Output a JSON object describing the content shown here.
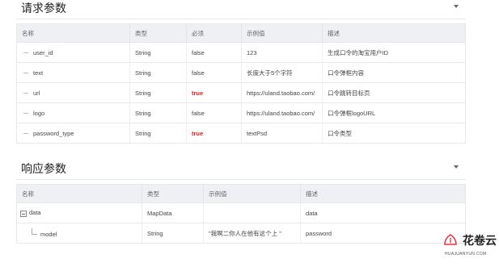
{
  "request": {
    "title": "请求参数",
    "headers": [
      "名称",
      "类型",
      "必须",
      "示例值",
      "描述"
    ],
    "rows": [
      {
        "name": "user_id",
        "type": "String",
        "required": "false",
        "example": "123",
        "desc": "生成口令的淘宝用户ID"
      },
      {
        "name": "text",
        "type": "String",
        "required": "false",
        "example": "长度大于5个字符",
        "desc": "口令弹框内容"
      },
      {
        "name": "url",
        "type": "String",
        "required": "true",
        "example": "https://uland.taobao.com/",
        "desc": "口令跳转目标页"
      },
      {
        "name": "logo",
        "type": "String",
        "required": "false",
        "example": "https://uland.taobao.com/",
        "desc": "口令弹框logoURL"
      },
      {
        "name": "password_type",
        "type": "String",
        "required": "true",
        "example": "textPsd",
        "desc": "口令类型"
      }
    ]
  },
  "response": {
    "title": "响应参数",
    "headers": [
      "名称",
      "类型",
      "示例值",
      "描述"
    ],
    "rows": [
      {
        "name": "data",
        "type": "MapData",
        "example": "",
        "desc": "data"
      },
      {
        "name": "model",
        "type": "String",
        "example": "\"我啊二你人在他有这个上 \"",
        "desc": "password"
      }
    ]
  },
  "watermark": {
    "text": "花卷云",
    "sub": "HUAJUANYUN.COM"
  },
  "colors": {
    "required_true": "#e02020",
    "header_bg": "#eef0f3",
    "watermark_icon": "#e8394a"
  }
}
